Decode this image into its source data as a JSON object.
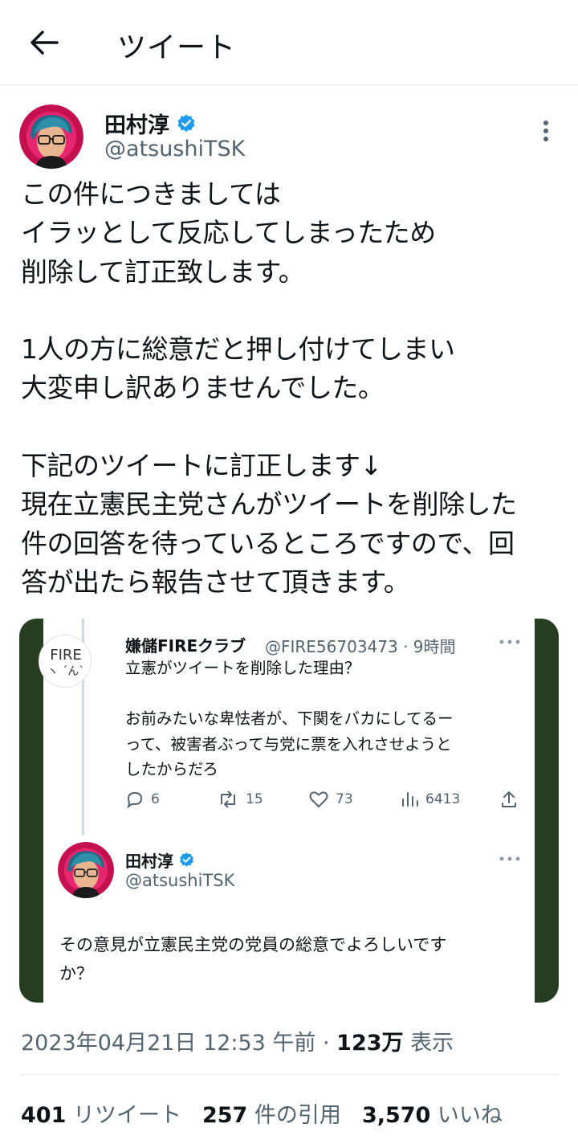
{
  "header": {
    "title": "ツイート",
    "back_icon": "arrow-left-icon"
  },
  "tweet": {
    "author_name": "田村淳",
    "author_handle": "@atsushiTSK",
    "verified_color": "#1d9bf0",
    "text": "この件につきましては\nイラッとして反応してしまったため\n削除して訂正致します。\n\n1人の方に総意だと押し付けてしまい\n大変申し訳ありませんでした。\n\n下記のツイートに訂正します↓\n現在立憲民主党さんがツイートを削除した\n件の回答を待っているところですので、回\n答が出たら報告させて頂きます。",
    "date": "2023年04月21日 12:53 午前",
    "separator": " · ",
    "views_count": "123万",
    "views_label": " 表示",
    "stats": [
      {
        "count": "401",
        "label": " リツイート"
      },
      {
        "count": "257",
        "label": " 件の引用"
      },
      {
        "count": "3,570",
        "label": " いいね"
      }
    ]
  },
  "embedded": {
    "frame_color": "#263d22",
    "reply": {
      "avatar_text": "FIRE",
      "avatar_sub": "ヽ ´ん`",
      "name": "嫌儲FIREクラブ",
      "handle": "@FIRE56703473 · 9時間",
      "text": "立憲がツイートを削除した理由？\n\nお前みたいな卑怯者が、下関をバカにしてるー\nって、被害者ぶって与党に票を入れさせようと\nしたからだろ",
      "actions": {
        "reply": "6",
        "retweet": "15",
        "like": "73",
        "views": "6413"
      }
    },
    "quote": {
      "name": "田村淳",
      "handle": "@atsushiTSK",
      "text": "その意見が立憲民主党の党員の総意でよろしいです\nか？"
    }
  }
}
